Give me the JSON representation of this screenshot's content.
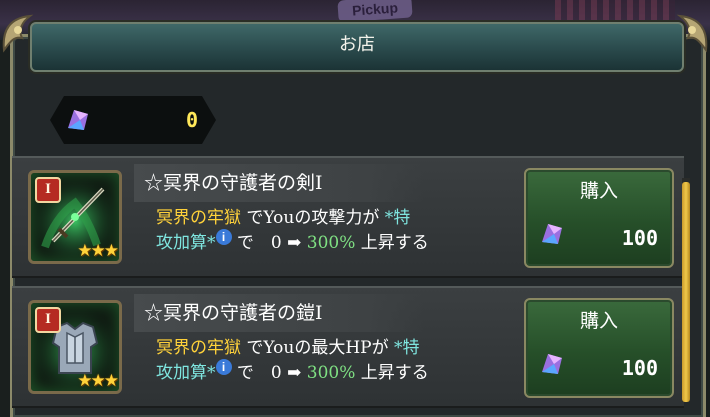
{
  "background": {
    "banner_text": "Pickup"
  },
  "header": {
    "title": "お店"
  },
  "currency": {
    "icon": "crystal-gem-icon",
    "amount": "0"
  },
  "items": [
    {
      "rank": "I",
      "stars": "★★★",
      "icon": "sword-icon",
      "name": "☆冥界の守護者の剣I",
      "location": "冥界の牢獄",
      "desc_line1_mid": "でYouの攻撃力が",
      "tag_part1": "*特",
      "tag_part2": "攻加算*",
      "info": "i",
      "desc_line2_rest": "で　0 ➡",
      "percent": "300%",
      "desc_end": "上昇する",
      "buy_label": "購入",
      "price": "100"
    },
    {
      "rank": "I",
      "stars": "★★★",
      "icon": "armor-icon",
      "name": "☆冥界の守護者の鎧I",
      "location": "冥界の牢獄",
      "desc_line1_mid": "でYouの最大HPが",
      "tag_part1": "*特",
      "tag_part2": "攻加算*",
      "info": "i",
      "desc_line2_rest": "で　0 ➡",
      "percent": "300%",
      "desc_end": "上昇する",
      "buy_label": "購入",
      "price": "100"
    }
  ]
}
